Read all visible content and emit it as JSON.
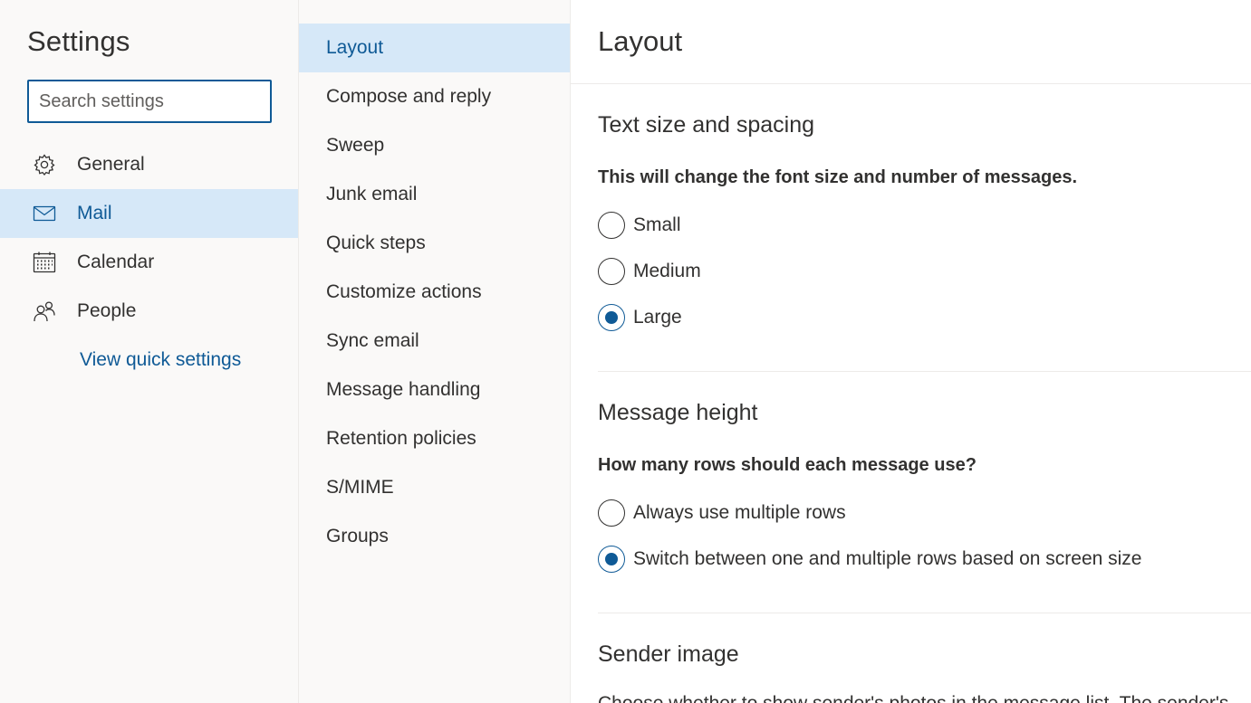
{
  "nav": {
    "title": "Settings",
    "search_placeholder": "Search settings",
    "items": [
      {
        "label": "General",
        "icon": "gear-icon",
        "selected": false
      },
      {
        "label": "Mail",
        "icon": "mail-icon",
        "selected": true
      },
      {
        "label": "Calendar",
        "icon": "calendar-icon",
        "selected": false
      },
      {
        "label": "People",
        "icon": "people-icon",
        "selected": false
      }
    ],
    "quick_settings_link": "View quick settings"
  },
  "subnav": {
    "items": [
      {
        "label": "Layout",
        "selected": true
      },
      {
        "label": "Compose and reply",
        "selected": false
      },
      {
        "label": "Sweep",
        "selected": false
      },
      {
        "label": "Junk email",
        "selected": false
      },
      {
        "label": "Quick steps",
        "selected": false
      },
      {
        "label": "Customize actions",
        "selected": false
      },
      {
        "label": "Sync email",
        "selected": false
      },
      {
        "label": "Message handling",
        "selected": false
      },
      {
        "label": "Retention policies",
        "selected": false
      },
      {
        "label": "S/MIME",
        "selected": false
      },
      {
        "label": "Groups",
        "selected": false
      }
    ]
  },
  "content": {
    "title": "Layout",
    "text_size": {
      "title": "Text size and spacing",
      "description": "This will change the font size and number of messages.",
      "options": [
        {
          "label": "Small",
          "checked": false
        },
        {
          "label": "Medium",
          "checked": false
        },
        {
          "label": "Large",
          "checked": true
        }
      ]
    },
    "message_height": {
      "title": "Message height",
      "description": "How many rows should each message use?",
      "options": [
        {
          "label": "Always use multiple rows",
          "checked": false
        },
        {
          "label": "Switch between one and multiple rows based on screen size",
          "checked": true
        }
      ]
    },
    "sender_image": {
      "title": "Sender image",
      "description_partial": "Choose whether to show sender's photos in the message list. The sender's"
    }
  },
  "colors": {
    "accent": "#0f5a96",
    "selected_bg": "#d6e8f8",
    "pane_bg": "#faf9f8",
    "divider": "#edebe9"
  }
}
